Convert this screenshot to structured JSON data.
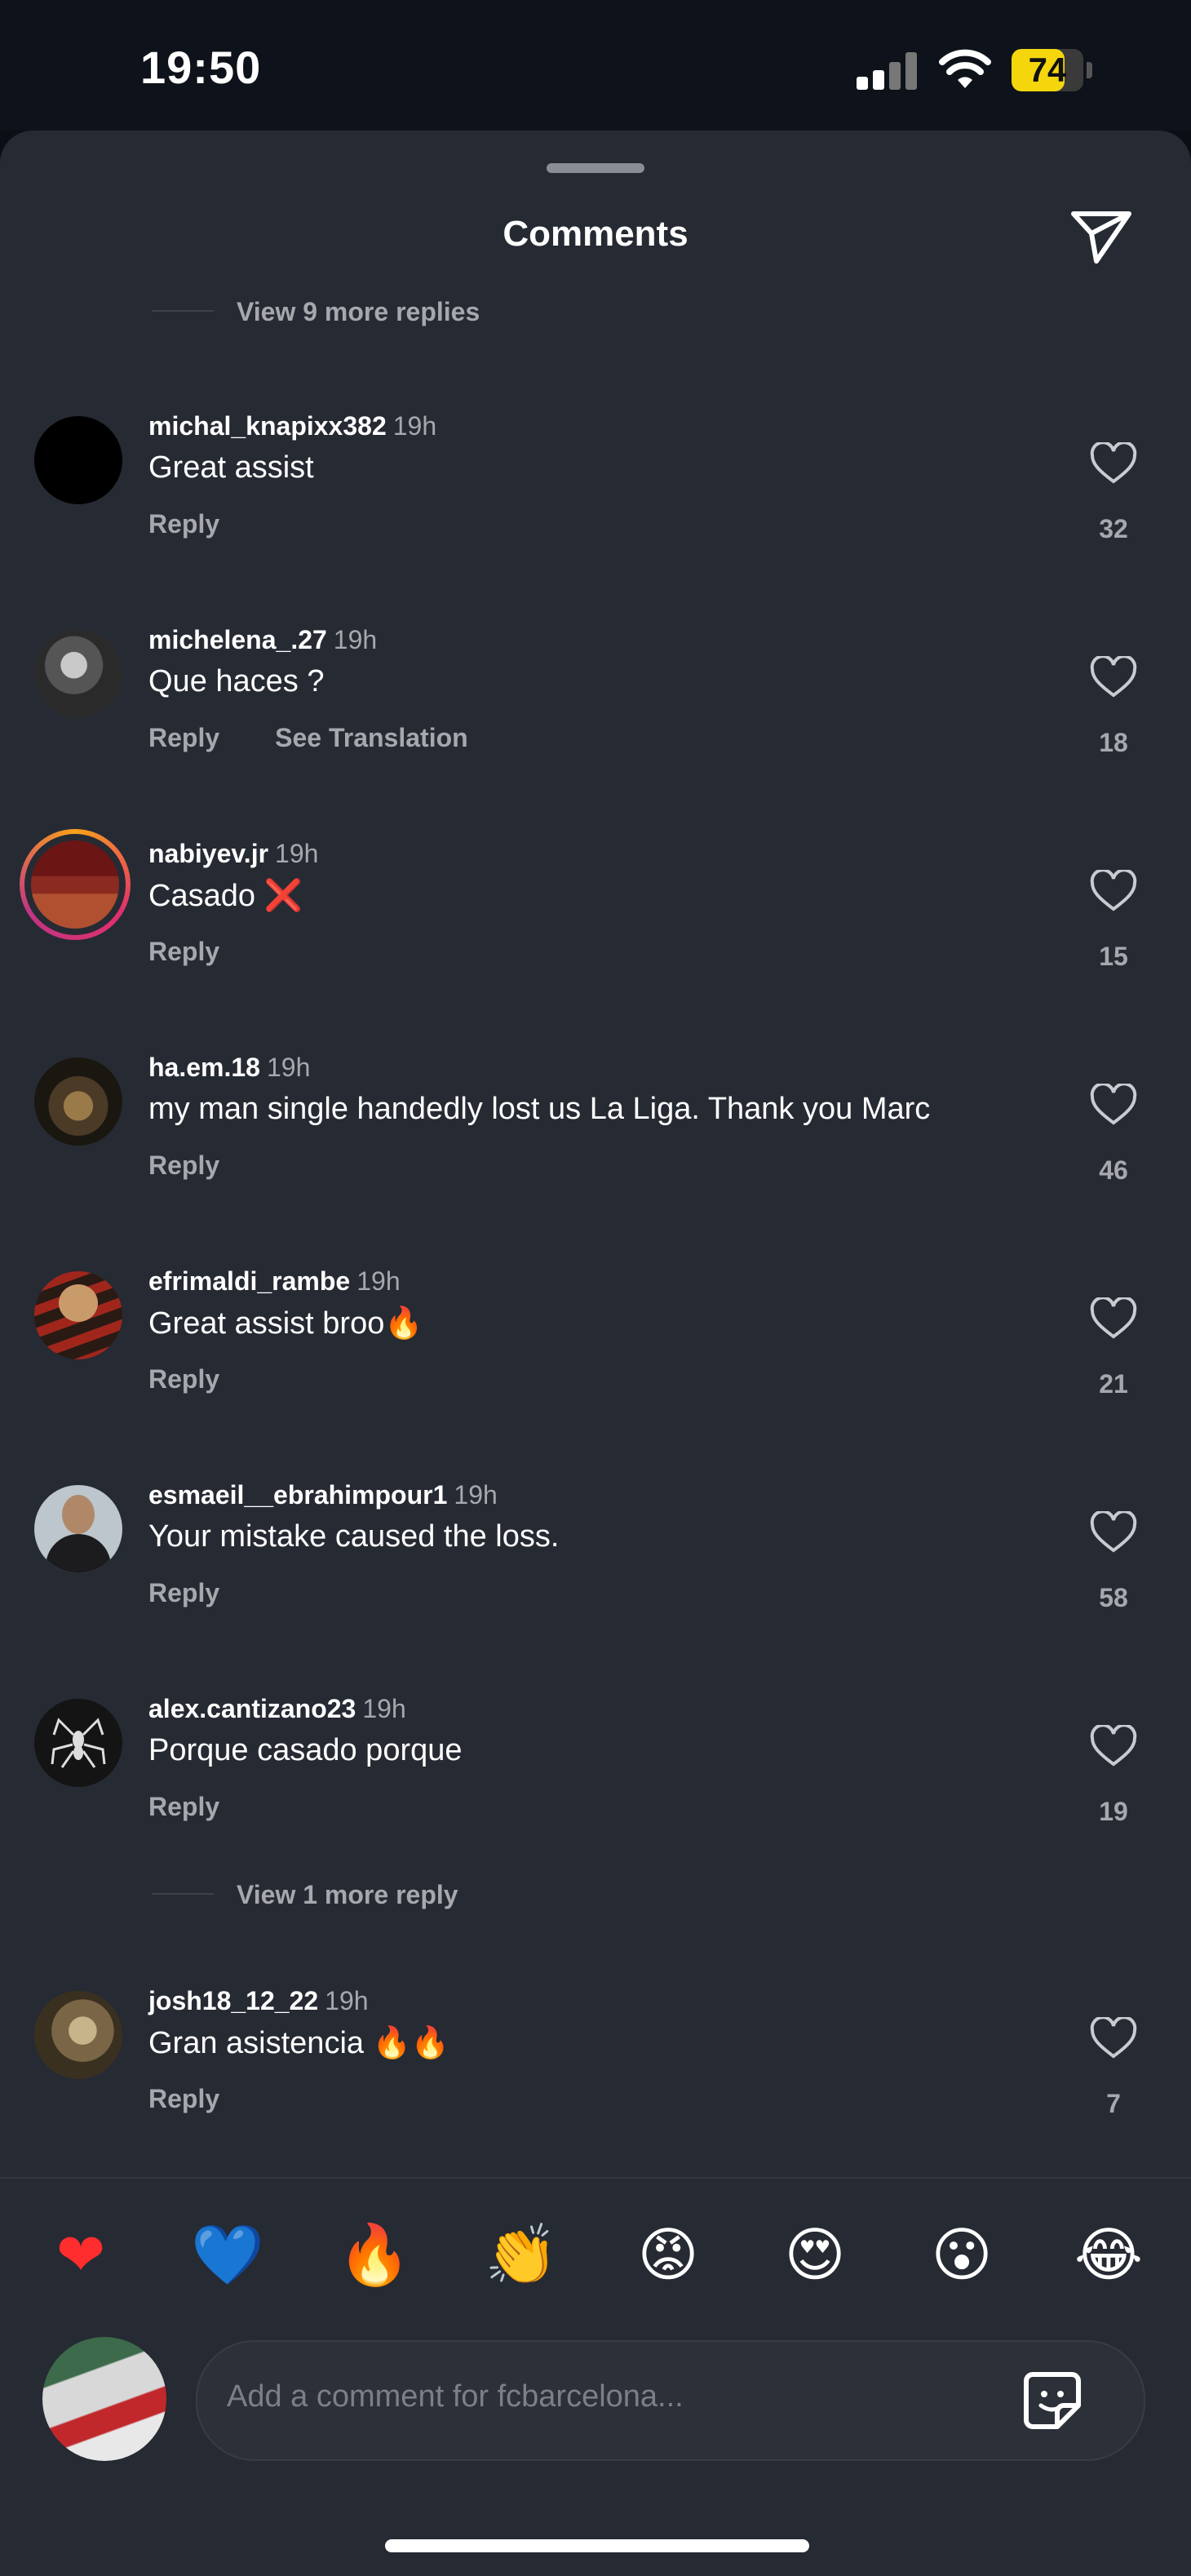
{
  "status": {
    "time": "19:50",
    "battery": "74",
    "battery_level": 0.74
  },
  "header": {
    "title": "Comments"
  },
  "thread_links": {
    "top": "View 9 more replies",
    "middle": "View 1 more reply"
  },
  "comments": [
    {
      "user": "michal_knapixx382",
      "time": "19h",
      "text": "Great assist",
      "reply": "Reply",
      "likes": "32"
    },
    {
      "user": "michelena_.27",
      "time": "19h",
      "text": "Que haces ?",
      "reply": "Reply",
      "translate": "See Translation",
      "likes": "18"
    },
    {
      "user": "nabiyev.jr",
      "time": "19h",
      "text": "Casado ❌",
      "reply": "Reply",
      "likes": "15"
    },
    {
      "user": "ha.em.18",
      "time": "19h",
      "text": "my man single handedly lost us La Liga. Thank you Marc",
      "reply": "Reply",
      "likes": "46"
    },
    {
      "user": "efrimaldi_rambe",
      "time": "19h",
      "text": "Great assist broo🔥",
      "reply": "Reply",
      "likes": "21"
    },
    {
      "user": "esmaeil__ebrahimpour1",
      "time": "19h",
      "text": "Your mistake caused the loss.",
      "reply": "Reply",
      "likes": "58"
    },
    {
      "user": "alex.cantizano23",
      "time": "19h",
      "text": "Porque casado porque",
      "reply": "Reply",
      "likes": "19"
    },
    {
      "user": "josh18_12_22",
      "time": "19h",
      "text": "Gran asistencia 🔥🔥",
      "reply": "Reply",
      "likes": "7"
    }
  ],
  "reactions": [
    "❤",
    "💙",
    "🔥",
    "👏",
    "😡",
    "😍",
    "😮",
    "😂"
  ],
  "composer": {
    "placeholder": "Add a comment for fcbarcelona..."
  },
  "colors": {
    "sheet": "#262a33",
    "muted": "#a6a8ad",
    "battery": "#f5d60d",
    "story_ring": "#e1306c"
  }
}
